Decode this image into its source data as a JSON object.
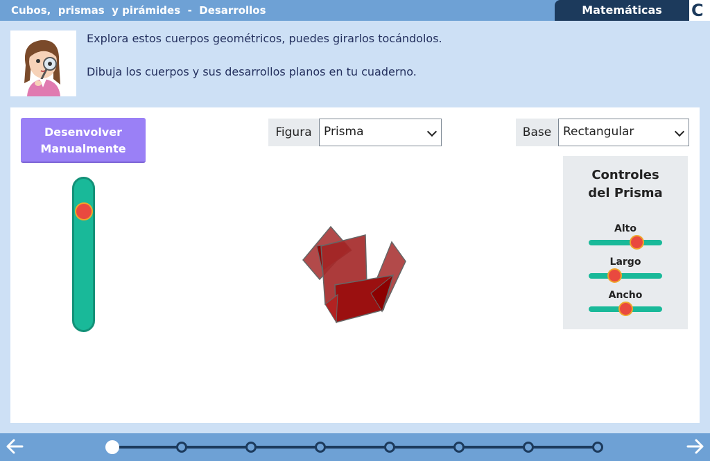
{
  "header": {
    "title": "Cubos,  prismas  y pirámides  -  Desarrollos",
    "subject": "Matemáticas",
    "logo_letter": "C"
  },
  "instructions": {
    "line1": "Explora estos cuerpos geométricos, puedes girarlos tocándolos.",
    "line2": "Dibuja los cuerpos y sus desarrollos planos en tu cuaderno."
  },
  "panel": {
    "unfold_button": "Desenvolver Manualmente",
    "figure_label": "Figura",
    "figure_value": "Prisma",
    "base_label": "Base",
    "base_value": "Rectangular",
    "unfold_level": 0.18,
    "controls": {
      "title": "Controles del Prisma",
      "sliders": [
        {
          "label": "Alto",
          "value": 0.65
        },
        {
          "label": "Largo",
          "value": 0.35
        },
        {
          "label": "Ancho",
          "value": 0.5
        }
      ]
    }
  },
  "footer": {
    "prev_icon": "arrow-left-icon",
    "next_icon": "arrow-right-icon",
    "steps_total": 8,
    "current_step": 1
  },
  "colors": {
    "header_bg": "#6ea1d5",
    "subject_bg": "#1c3a5c",
    "button_purple": "#9a80f6",
    "slider_green": "#19b999",
    "knob_red": "#e9493f",
    "shape_red": "#a01414"
  }
}
